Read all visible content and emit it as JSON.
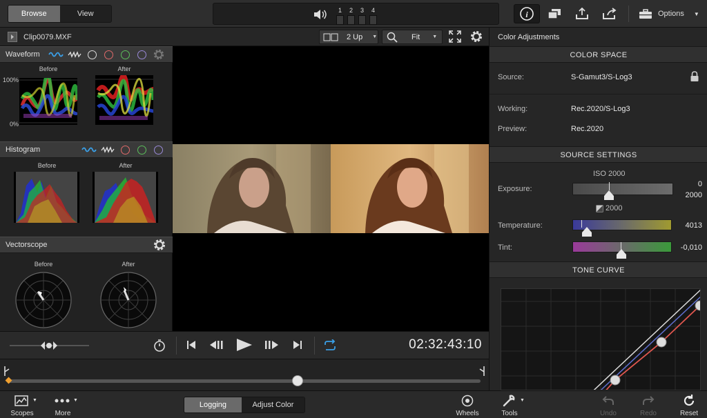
{
  "top": {
    "browse": "Browse",
    "view": "View",
    "channels": [
      "1",
      "2",
      "3",
      "4"
    ],
    "options": "Options"
  },
  "clip": {
    "name": "Clip0079.MXF",
    "layout": "2 Up",
    "zoom": "Fit"
  },
  "scopes": {
    "waveform": {
      "title": "Waveform",
      "before": "Before",
      "after": "After",
      "top_label": "100%",
      "bottom_label": "0%"
    },
    "histogram": {
      "title": "Histogram",
      "before": "Before",
      "after": "After"
    },
    "vectorscope": {
      "title": "Vectorscope",
      "before": "Before",
      "after": "After"
    }
  },
  "transport": {
    "timecode": "02:32:43:10"
  },
  "right": {
    "title": "Color Adjustments",
    "color_space": {
      "header": "COLOR SPACE",
      "source_label": "Source:",
      "source_value": "S-Gamut3/S-Log3",
      "working_label": "Working:",
      "working_value": "Rec.2020/S-Log3",
      "preview_label": "Preview:",
      "preview_value": "Rec.2020"
    },
    "source_settings": {
      "header": "SOURCE SETTINGS",
      "iso": "ISO 2000",
      "exposure_label": "Exposure:",
      "exposure_value": "0",
      "exposure_value2": "2000",
      "exposure_sub": "2000",
      "temperature_label": "Temperature:",
      "temperature_value": "4013",
      "tint_label": "Tint:",
      "tint_value": "-0,010"
    },
    "tone_curve": {
      "header": "TONE CURVE"
    }
  },
  "bottom": {
    "scopes": "Scopes",
    "more": "More",
    "logging": "Logging",
    "adjust_color": "Adjust Color",
    "wheels": "Wheels",
    "tools": "Tools",
    "undo": "Undo",
    "redo": "Redo",
    "reset": "Reset"
  },
  "colors": {
    "accent": "#3aa0e8",
    "red_circle": "#e06a6a",
    "green_circle": "#5bbf5b",
    "blue_circle": "#9a8ad8",
    "curve_red": "#e0574f"
  }
}
